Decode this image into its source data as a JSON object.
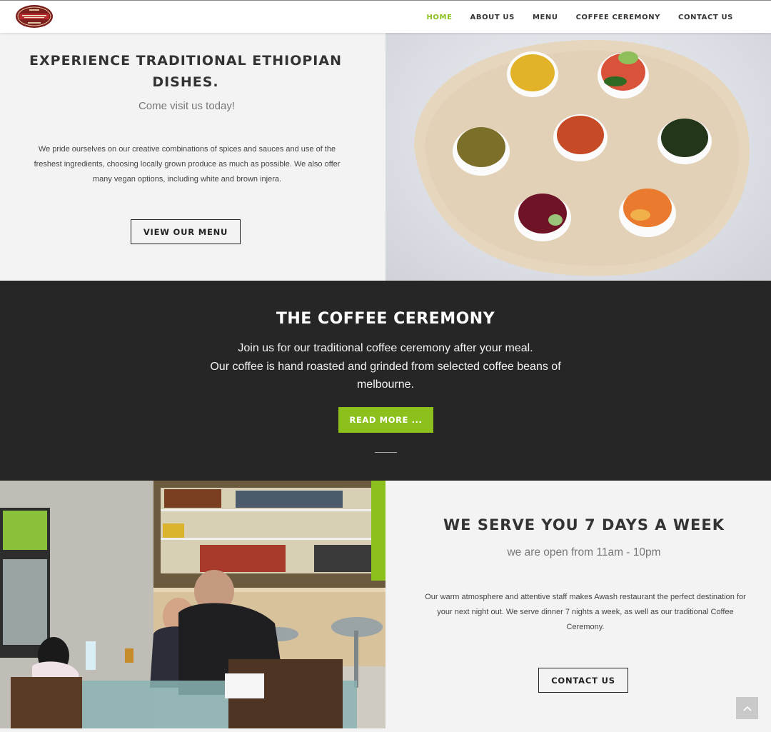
{
  "header": {
    "logo_alt": "Awash restaurant logo",
    "nav": [
      {
        "label": "HOME",
        "active": true
      },
      {
        "label": "ABOUT US",
        "active": false
      },
      {
        "label": "MENU",
        "active": false
      },
      {
        "label": "COFFEE CEREMONY",
        "active": false
      },
      {
        "label": "CONTACT US",
        "active": false
      }
    ]
  },
  "hero": {
    "title": "EXPERIENCE TRADITIONAL ETHIOPIAN DISHES.",
    "subtitle": "Come visit us today!",
    "body": "We pride ourselves on our creative combinations of spices and sauces and use of the freshest ingredients, choosing locally grown produce as much as possible. We also offer many vegan options, including white and brown injera.",
    "button": "VIEW OUR MENU"
  },
  "coffee": {
    "title": "THE COFFEE CEREMONY",
    "line1": "Join us for our traditional coffee ceremony after your meal.",
    "line2": "Our coffee is hand roasted and grinded from selected coffee beans of melbourne.",
    "button": "READ MORE ..."
  },
  "hours": {
    "title": "WE SERVE YOU 7 DAYS A WEEK",
    "subtitle": "we are open from 11am - 10pm",
    "body": "Our warm atmosphere and attentive staff makes Awash restaurant the perfect destination for your next night out. We serve dinner 7 nights a week, as well as our traditional Coffee Ceremony.",
    "button": "CONTACT US"
  },
  "colors": {
    "accent": "#8cc11d",
    "dark_band": "#262626",
    "light_bg": "#f3f3f3"
  },
  "icons": {
    "scroll_top": "chevron-up-icon"
  }
}
